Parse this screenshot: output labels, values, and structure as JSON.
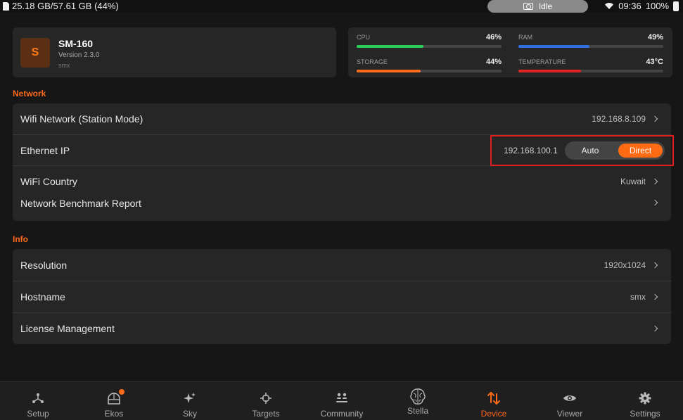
{
  "statusbar": {
    "storage": "25.18 GB/57.61 GB (44%)",
    "status": "Idle",
    "time": "09:36",
    "battery": "100%"
  },
  "device": {
    "initial": "S",
    "name": "SM-160",
    "version": "Version 2.3.0",
    "host": "smx"
  },
  "stats": {
    "cpu": {
      "label": "CPU",
      "value": "46%",
      "percent": 46,
      "color": "#2ecc58"
    },
    "ram": {
      "label": "RAM",
      "value": "49%",
      "percent": 49,
      "color": "#2f6fe0"
    },
    "storage": {
      "label": "STORAGE",
      "value": "44%",
      "percent": 44,
      "color": "#ff6a1a"
    },
    "temperature": {
      "label": "TEMPERATURE",
      "value": "43°C",
      "percent": 43,
      "color": "#e02424"
    }
  },
  "network": {
    "title": "Network",
    "wifi": {
      "label": "Wifi Network (Station Mode)",
      "value": "192.168.8.109"
    },
    "ethernet": {
      "label": "Ethernet IP",
      "value": "192.168.100.1",
      "mode_auto": "Auto",
      "mode_direct": "Direct",
      "selected": "Direct"
    },
    "country": {
      "label": "WiFi Country",
      "value": "Kuwait"
    },
    "benchmark": {
      "label": "Network Benchmark Report"
    }
  },
  "info": {
    "title": "Info",
    "resolution": {
      "label": "Resolution",
      "value": "1920x1024"
    },
    "hostname": {
      "label": "Hostname",
      "value": "smx"
    },
    "license": {
      "label": "License Management"
    }
  },
  "nav": {
    "setup": "Setup",
    "ekos": "Ekos",
    "sky": "Sky",
    "targets": "Targets",
    "community": "Community",
    "stella": "Stella",
    "device": "Device",
    "viewer": "Viewer",
    "settings": "Settings",
    "active": "Device",
    "accent": "#ff6a1a"
  }
}
